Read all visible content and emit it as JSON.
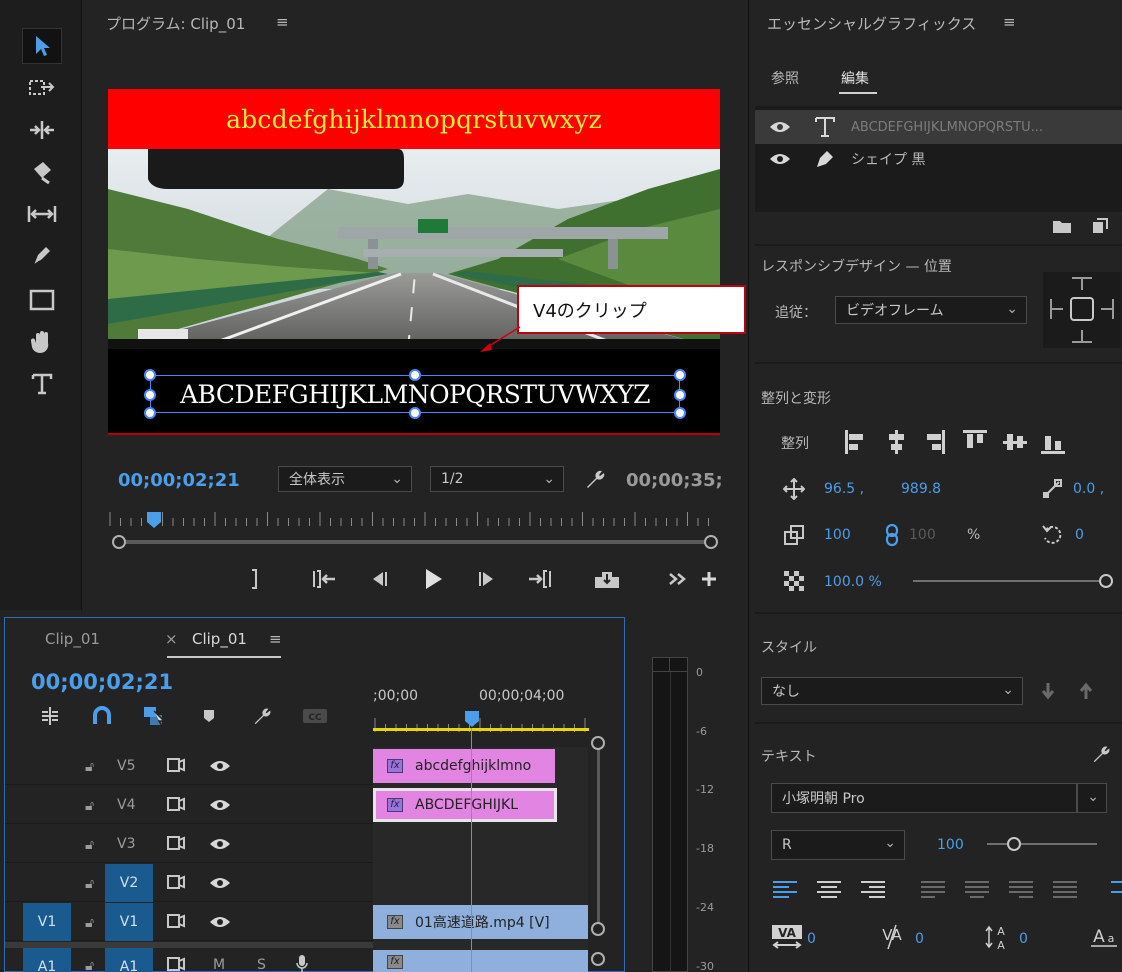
{
  "program": {
    "title": "プログラム: Clip_01",
    "menu": "≡",
    "top_text": "abcdefghijklmnopqrstuvwxyz",
    "caption_text": "ABCDEFGHIJKLMNOPQRSTUVWXYZ",
    "callout": "V4のクリップ",
    "timecode": "00;00;02;21",
    "zoom": "全体表示",
    "resolution": "1/2",
    "duration": "00;00;35;"
  },
  "essential_graphics": {
    "title": "エッセンシャルグラフィックス",
    "menu": "≡",
    "tabs": [
      "参照",
      "編集"
    ],
    "layers": [
      {
        "name": "ABCDEFGHIJKLMNOPQRSTU...",
        "icon": "text-icon"
      },
      {
        "name": "シェイプ 黒",
        "icon": "pen-icon"
      }
    ],
    "responsive": {
      "title": "レスポンシブデザイン — 位置",
      "follow_label": "追従：",
      "follow_value": "ビデオフレーム"
    },
    "align": {
      "title": "整列と変形",
      "align_label": "整列",
      "pos_x": "96.5 ,",
      "pos_y": "989.8",
      "anchor": "0.0 ,",
      "scale": "100",
      "scale_linked": "100",
      "percent": "%",
      "rotation": "0",
      "opacity": "100.0 %",
      "opacity_fraction": 1.0
    },
    "style": {
      "title": "スタイル",
      "value": "なし"
    },
    "text": {
      "title": "テキスト",
      "font": "小塚明朝 Pro",
      "weight": "R",
      "size": "100",
      "size_fraction": 0.2,
      "tracking": "0",
      "kerning": "0",
      "leading": "0"
    }
  },
  "timeline": {
    "tabs": [
      "Clip_01",
      "Clip_01"
    ],
    "close": "×",
    "menu": "≡",
    "timecode": "00;00;02;21",
    "ruler": [
      ";00;00",
      "00;00;04;00"
    ],
    "tracks": [
      {
        "label": "V5",
        "source": "",
        "clip": "abcdefghijklmno"
      },
      {
        "label": "V4",
        "source": "",
        "clip": "ABCDEFGHIJKL"
      },
      {
        "label": "V3",
        "source": "",
        "clip": ""
      },
      {
        "label": "V2",
        "source": "",
        "clip": "",
        "highlight": true
      },
      {
        "label": "V1",
        "source": "V1",
        "clip": "01高速道路.mp4 [V]",
        "highlight": true
      },
      {
        "label": "A1",
        "source": "A1",
        "mute": "M",
        "solo": "S",
        "clip": "",
        "highlight": true
      }
    ],
    "fx": "fx"
  },
  "meter": {
    "labels": [
      "0",
      "-6",
      "-12",
      "-18",
      "-24",
      "-30"
    ]
  },
  "colors": {
    "accent": "#4b9eea",
    "title_bar": "#ff0000",
    "title_text": "#f6ea3a",
    "graphic_clip": "#e284e2",
    "video_clip": "#8fb0dc",
    "track_highlight": "#1b5a8f"
  }
}
